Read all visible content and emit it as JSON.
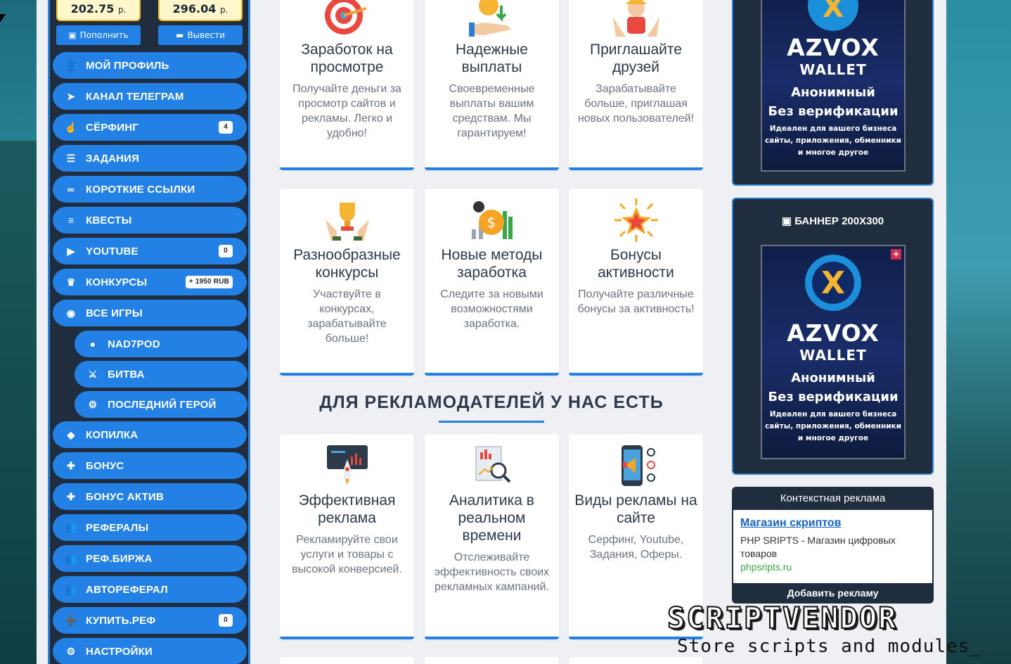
{
  "balances": [
    {
      "amount": "202.75",
      "unit": "р."
    },
    {
      "amount": "296.04",
      "unit": "р."
    }
  ],
  "actions": {
    "deposit_label": "Пополнить",
    "withdraw_label": "Вывести"
  },
  "nav": {
    "items": [
      {
        "label": "МОЙ ПРОФИЛЬ",
        "icon": "user-icon"
      },
      {
        "label": "КАНАЛ ТЕЛЕГРАМ",
        "icon": "telegram-icon"
      },
      {
        "label": "СЁРФИНГ",
        "icon": "hand-pointer-icon",
        "badge": "4"
      },
      {
        "label": "ЗАДАНИЯ",
        "icon": "list-check-icon"
      },
      {
        "label": "КОРОТКИЕ ССЫЛКИ",
        "icon": "link-icon"
      },
      {
        "label": "КВЕСТЫ",
        "icon": "layers-icon"
      },
      {
        "label": "YOUTUBE",
        "icon": "youtube-icon",
        "badge": "0"
      },
      {
        "label": "КОНКУРСЫ",
        "icon": "trophy-icon",
        "badge": "+ 1950 RUB"
      },
      {
        "label": "ВСЕ ИГРЫ",
        "icon": "gamepad-icon"
      },
      {
        "label": "NAD7POD",
        "icon": "chat-icon"
      },
      {
        "label": "БИТВА",
        "icon": "sword-icon"
      },
      {
        "label": "ПОСЛЕДНИЙ ГЕРОЙ",
        "icon": "user-gear-icon"
      },
      {
        "label": "КОПИЛКА",
        "icon": "piggy-bank-icon"
      },
      {
        "label": "БОНУС",
        "icon": "gift-icon"
      },
      {
        "label": "БОНУС АКТИВ",
        "icon": "gift-icon"
      },
      {
        "label": "РЕФЕРАЛЫ",
        "icon": "users-icon"
      },
      {
        "label": "РЕФ.БИРЖА",
        "icon": "users-icon"
      },
      {
        "label": "АВТОРЕФЕРАЛ",
        "icon": "users-icon"
      },
      {
        "label": "КУПИТЬ.РЕФ",
        "icon": "user-plus-icon",
        "badge": "0"
      },
      {
        "label": "НАСТРОЙКИ",
        "icon": "gear-icon"
      }
    ]
  },
  "features": [
    {
      "title": "Заработок на просмотре",
      "text": "Получайте деньги за просмотр сайтов и рекламы. Легко и удобно!",
      "icon": "target-icon"
    },
    {
      "title": "Надежные выплаты",
      "text": "Своевременные выплаты вашим средствам. Мы гарантируем!",
      "icon": "coin-hand-icon"
    },
    {
      "title": "Приглашайте друзей",
      "text": "Зарабатывайте больше, приглашая новых пользователей!",
      "icon": "friends-icon"
    },
    {
      "title": "Разнообразные конкурсы",
      "text": "Участвуйте в конкурсах, зарабатывайте больше!",
      "icon": "trophy-hands-icon"
    },
    {
      "title": "Новые методы заработка",
      "text": "Следите за новыми возможностями заработка.",
      "icon": "dollar-chart-icon"
    },
    {
      "title": "Бонусы активности",
      "text": "Получайте различные бонусы за активность!",
      "icon": "star-icon"
    }
  ],
  "advertisers": {
    "title": "ДЛЯ РЕКЛАМОДАТЕЛЕЙ У НАС ЕСТЬ",
    "cards": [
      {
        "title": "Эффективная реклама",
        "text": "Рекламируйте свои услуги и товары с высокой конверсией.",
        "icon": "rocket-screen-icon"
      },
      {
        "title": "Аналитика в реальном времени",
        "text": "Отслеживайте эффективность своих рекламных кампаний.",
        "icon": "analytics-icon"
      },
      {
        "title": "Виды рекламы на сайте",
        "text": "Серфинг, Youtube, Задания, Оферы.",
        "icon": "megaphone-phone-icon"
      }
    ]
  },
  "right": {
    "banner_title": "БАННЕР 200Х300",
    "ad": {
      "name": "AZVOX",
      "sub": "WALLET",
      "line1": "Анонимный",
      "line2": "Без верификации",
      "line3": "Идеален для вашего бизнеса",
      "line4": "сайты, приложения, обменники",
      "line5": "и многое другое"
    },
    "plus": "+",
    "context": {
      "header": "Контекстная реклама",
      "link": "Магазин скриптов",
      "desc": "PHP SRIPTS - Магазин цифровых товаров",
      "url": "phpsripts.ru",
      "footer": "Добавить рекламу"
    }
  },
  "watermark": {
    "logo": "SCRIPTVENDOR",
    "tagline": "Store scripts and modules_"
  },
  "colors": {
    "accent": "#2381e6",
    "sidebar": "#1f2d3f",
    "balance_bg": "#fff7cc"
  }
}
